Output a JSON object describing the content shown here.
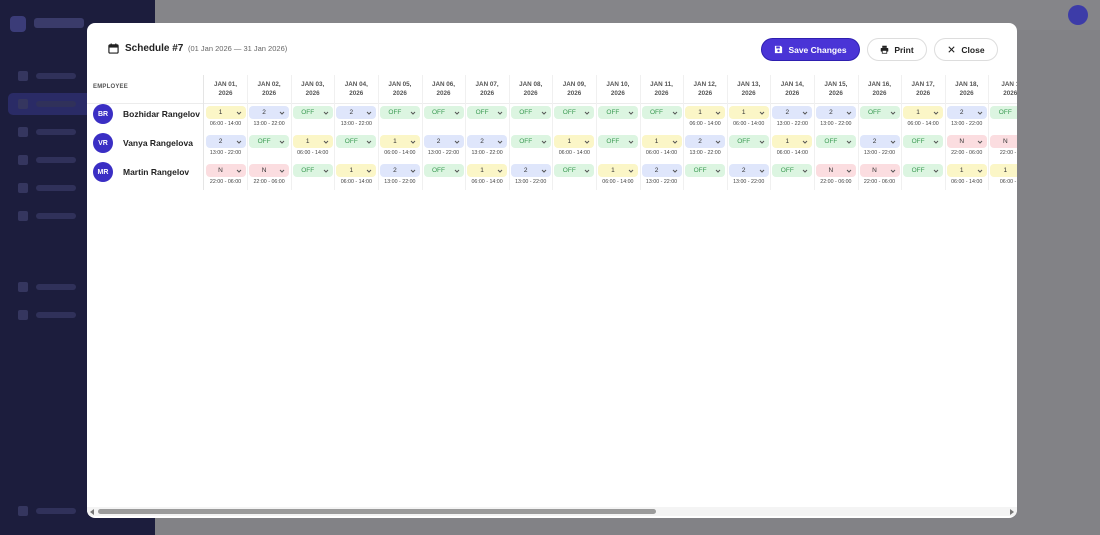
{
  "modal": {
    "title": "Schedule #7",
    "subtitle": "(01 Jan 2026 — 31 Jan 2026)",
    "save_label": "Save Changes",
    "print_label": "Print",
    "close_label": "Close"
  },
  "grid": {
    "employee_header": "EMPLOYEE",
    "days": [
      {
        "line1": "JAN 01,",
        "line2": "2026"
      },
      {
        "line1": "JAN 02,",
        "line2": "2026"
      },
      {
        "line1": "JAN 03,",
        "line2": "2026"
      },
      {
        "line1": "JAN 04,",
        "line2": "2026"
      },
      {
        "line1": "JAN 05,",
        "line2": "2026"
      },
      {
        "line1": "JAN 06,",
        "line2": "2026"
      },
      {
        "line1": "JAN 07,",
        "line2": "2026"
      },
      {
        "line1": "JAN 08,",
        "line2": "2026"
      },
      {
        "line1": "JAN 09,",
        "line2": "2026"
      },
      {
        "line1": "JAN 10,",
        "line2": "2026"
      },
      {
        "line1": "JAN 11,",
        "line2": "2026"
      },
      {
        "line1": "JAN 12,",
        "line2": "2026"
      },
      {
        "line1": "JAN 13,",
        "line2": "2026"
      },
      {
        "line1": "JAN 14,",
        "line2": "2026"
      },
      {
        "line1": "JAN 15,",
        "line2": "2026"
      },
      {
        "line1": "JAN 16,",
        "line2": "2026"
      },
      {
        "line1": "JAN 17,",
        "line2": "2026"
      },
      {
        "line1": "JAN 18,",
        "line2": "2026"
      },
      {
        "line1": "JAN 1",
        "line2": "2026"
      }
    ],
    "employees": [
      {
        "initials": "BR",
        "name": "Bozhidar Rangelov",
        "shifts": [
          {
            "v": "1",
            "t": "06:00 - 14:00"
          },
          {
            "v": "2",
            "t": "13:00 - 22:00"
          },
          {
            "v": "OFF",
            "t": ""
          },
          {
            "v": "2",
            "t": "13:00 - 22:00"
          },
          {
            "v": "OFF",
            "t": ""
          },
          {
            "v": "OFF",
            "t": ""
          },
          {
            "v": "OFF",
            "t": ""
          },
          {
            "v": "OFF",
            "t": ""
          },
          {
            "v": "OFF",
            "t": ""
          },
          {
            "v": "OFF",
            "t": ""
          },
          {
            "v": "OFF",
            "t": ""
          },
          {
            "v": "1",
            "t": "06:00 - 14:00"
          },
          {
            "v": "1",
            "t": "06:00 - 14:00"
          },
          {
            "v": "2",
            "t": "13:00 - 22:00"
          },
          {
            "v": "2",
            "t": "13:00 - 22:00"
          },
          {
            "v": "OFF",
            "t": ""
          },
          {
            "v": "1",
            "t": "06:00 - 14:00"
          },
          {
            "v": "2",
            "t": "13:00 - 22:00"
          },
          {
            "v": "OFF",
            "t": ""
          }
        ]
      },
      {
        "initials": "VR",
        "name": "Vanya Rangelova",
        "shifts": [
          {
            "v": "2",
            "t": "13:00 - 22:00"
          },
          {
            "v": "OFF",
            "t": ""
          },
          {
            "v": "1",
            "t": "06:00 - 14:00"
          },
          {
            "v": "OFF",
            "t": ""
          },
          {
            "v": "1",
            "t": "06:00 - 14:00"
          },
          {
            "v": "2",
            "t": "13:00 - 22:00"
          },
          {
            "v": "2",
            "t": "13:00 - 22:00"
          },
          {
            "v": "OFF",
            "t": ""
          },
          {
            "v": "1",
            "t": "06:00 - 14:00"
          },
          {
            "v": "OFF",
            "t": ""
          },
          {
            "v": "1",
            "t": "06:00 - 14:00"
          },
          {
            "v": "2",
            "t": "13:00 - 22:00"
          },
          {
            "v": "OFF",
            "t": ""
          },
          {
            "v": "1",
            "t": "06:00 - 14:00"
          },
          {
            "v": "OFF",
            "t": ""
          },
          {
            "v": "2",
            "t": "13:00 - 22:00"
          },
          {
            "v": "OFF",
            "t": ""
          },
          {
            "v": "N",
            "t": "22:00 - 06:00"
          },
          {
            "v": "N",
            "t": "22:00 - 0"
          }
        ]
      },
      {
        "initials": "MR",
        "name": "Martin Rangelov",
        "shifts": [
          {
            "v": "N",
            "t": "22:00 - 06:00"
          },
          {
            "v": "N",
            "t": "22:00 - 06:00"
          },
          {
            "v": "OFF",
            "t": ""
          },
          {
            "v": "1",
            "t": "06:00 - 14:00"
          },
          {
            "v": "2",
            "t": "13:00 - 22:00"
          },
          {
            "v": "OFF",
            "t": ""
          },
          {
            "v": "1",
            "t": "06:00 - 14:00"
          },
          {
            "v": "2",
            "t": "13:00 - 22:00"
          },
          {
            "v": "OFF",
            "t": ""
          },
          {
            "v": "1",
            "t": "06:00 - 14:00"
          },
          {
            "v": "2",
            "t": "13:00 - 22:00"
          },
          {
            "v": "OFF",
            "t": ""
          },
          {
            "v": "2",
            "t": "13:00 - 22:00"
          },
          {
            "v": "OFF",
            "t": ""
          },
          {
            "v": "N",
            "t": "22:00 - 06:00"
          },
          {
            "v": "N",
            "t": "22:00 - 06:00"
          },
          {
            "v": "OFF",
            "t": ""
          },
          {
            "v": "1",
            "t": "06:00 - 14:00"
          },
          {
            "v": "1",
            "t": "06:00 - 1"
          }
        ]
      }
    ]
  },
  "colors": {
    "accent": "#4a34d6",
    "shift_1": "#fbf6c7",
    "shift_2": "#dfe6fb",
    "shift_off": "#dcf5e1",
    "shift_n": "#fbdde0"
  }
}
